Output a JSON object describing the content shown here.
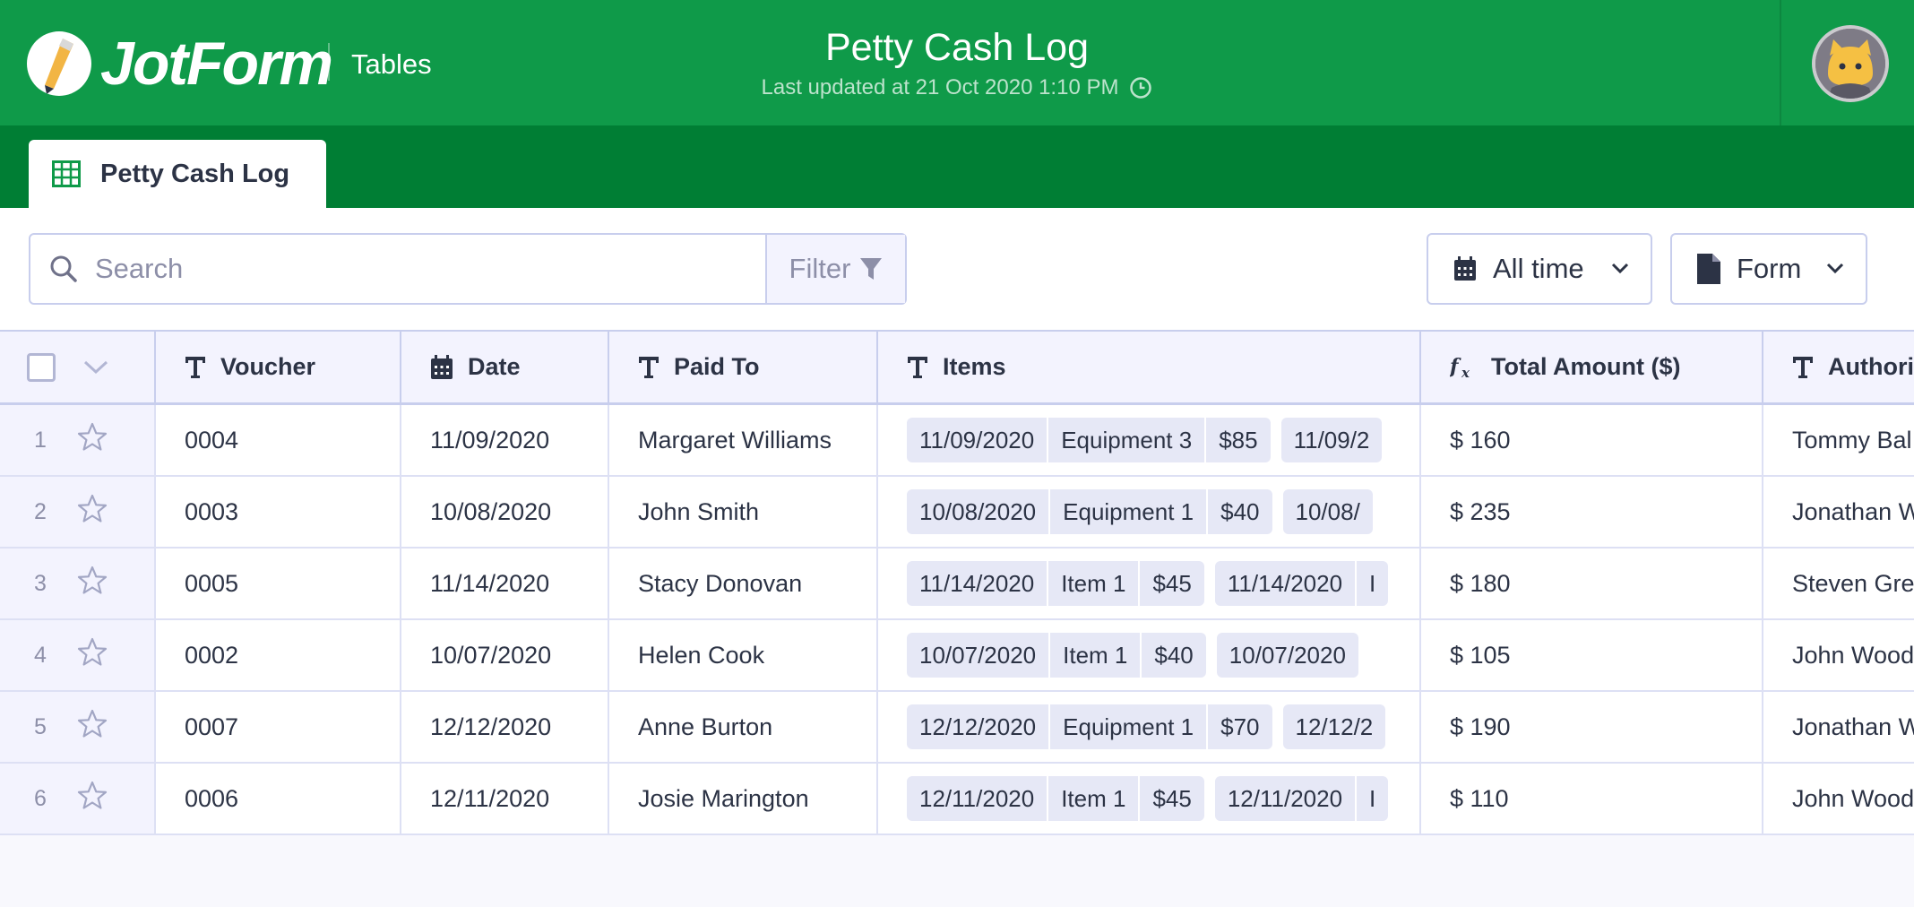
{
  "app": {
    "logo_text": "JotForm",
    "section": "Tables"
  },
  "header": {
    "title": "Petty Cash Log",
    "last_updated": "Last updated at 21 Oct 2020 1:10 PM"
  },
  "tab": {
    "label": "Petty Cash Log"
  },
  "toolbar": {
    "search_placeholder": "Search",
    "filter_label": "Filter",
    "time_label": "All time",
    "form_label": "Form"
  },
  "columns": [
    "Voucher",
    "Date",
    "Paid To",
    "Items",
    "Total Amount ($)",
    "Authori"
  ],
  "rows": [
    {
      "num": "1",
      "voucher": "0004",
      "date": "11/09/2020",
      "paid_to": "Margaret Williams",
      "chip1": [
        "11/09/2020",
        "Equipment 3",
        "$85"
      ],
      "chip2": [
        "11/09/2"
      ],
      "total": "$ 160",
      "auth": "Tommy Bal"
    },
    {
      "num": "2",
      "voucher": "0003",
      "date": "10/08/2020",
      "paid_to": "John Smith",
      "chip1": [
        "10/08/2020",
        "Equipment 1",
        "$40"
      ],
      "chip2": [
        "10/08/"
      ],
      "total": "$ 235",
      "auth": "Jonathan W"
    },
    {
      "num": "3",
      "voucher": "0005",
      "date": "11/14/2020",
      "paid_to": "Stacy Donovan",
      "chip1": [
        "11/14/2020",
        "Item 1",
        "$45"
      ],
      "chip2": [
        "11/14/2020",
        "I"
      ],
      "total": "$ 180",
      "auth": "Steven Gre"
    },
    {
      "num": "4",
      "voucher": "0002",
      "date": "10/07/2020",
      "paid_to": "Helen Cook",
      "chip1": [
        "10/07/2020",
        "Item 1",
        "$40"
      ],
      "chip2": [
        "10/07/2020"
      ],
      "total": "$ 105",
      "auth": "John Wood"
    },
    {
      "num": "5",
      "voucher": "0007",
      "date": "12/12/2020",
      "paid_to": "Anne Burton",
      "chip1": [
        "12/12/2020",
        "Equipment 1",
        "$70"
      ],
      "chip2": [
        "12/12/2"
      ],
      "total": "$ 190",
      "auth": "Jonathan W"
    },
    {
      "num": "6",
      "voucher": "0006",
      "date": "12/11/2020",
      "paid_to": "Josie Marington",
      "chip1": [
        "12/11/2020",
        "Item 1",
        "$45"
      ],
      "chip2": [
        "12/11/2020",
        "I"
      ],
      "total": "$ 110",
      "auth": "John Wood"
    }
  ]
}
